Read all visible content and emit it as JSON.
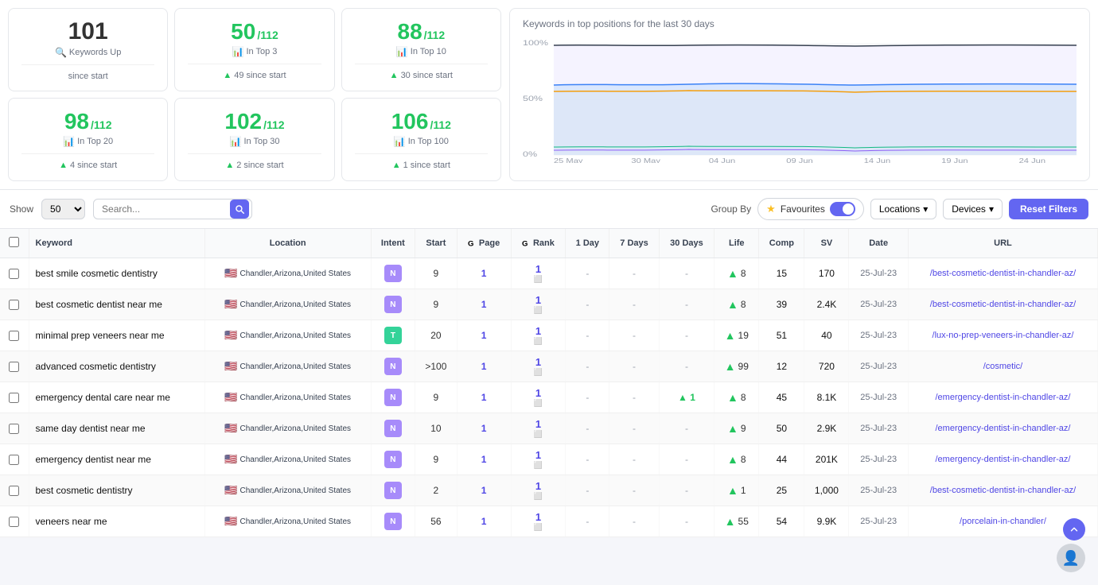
{
  "stats": [
    {
      "id": "keywords-up",
      "main": "101",
      "mainColor": "black",
      "icon": "🔍",
      "label": "Keywords Up",
      "since": "since start",
      "sinceArrow": false,
      "sinceNum": ""
    },
    {
      "id": "top3",
      "main": "50",
      "sup": "/112",
      "mainColor": "green",
      "icon": "📊",
      "label": "In Top 3",
      "since": "since start",
      "sinceArrow": true,
      "sinceNum": "49"
    },
    {
      "id": "top10",
      "main": "88",
      "sup": "/112",
      "mainColor": "green",
      "icon": "📊",
      "label": "In Top 10",
      "since": "since start",
      "sinceArrow": true,
      "sinceNum": "30"
    },
    {
      "id": "top20",
      "main": "98",
      "sup": "/112",
      "mainColor": "green",
      "icon": "📊",
      "label": "In Top 20",
      "since": "since start",
      "sinceArrow": true,
      "sinceNum": "4"
    },
    {
      "id": "top30",
      "main": "102",
      "sup": "/112",
      "mainColor": "green",
      "icon": "📊",
      "label": "In Top 30",
      "since": "since start",
      "sinceArrow": true,
      "sinceNum": "2"
    },
    {
      "id": "top100",
      "main": "106",
      "sup": "/112",
      "mainColor": "green",
      "icon": "📊",
      "label": "In Top 100",
      "since": "since start",
      "sinceArrow": true,
      "sinceNum": "1"
    }
  ],
  "chart": {
    "title": "Keywords in top positions for the last 30 days",
    "xLabels": [
      "25 May",
      "30 May",
      "04 Jun",
      "09 Jun",
      "14 Jun",
      "19 Jun",
      "24 Jun"
    ],
    "yLabels": [
      "0%",
      "50%",
      "100%"
    ]
  },
  "toolbar": {
    "show_label": "Show",
    "show_value": "50",
    "search_placeholder": "Search...",
    "group_by": "Group By",
    "favourites_label": "Favourites",
    "locations_label": "Locations",
    "devices_label": "Devices",
    "reset_label": "Reset Filters"
  },
  "table": {
    "columns": [
      "",
      "Keyword",
      "Location",
      "Intent",
      "Start",
      "Page",
      "Rank",
      "1 Day",
      "7 Days",
      "30 Days",
      "Life",
      "Comp",
      "SV",
      "Date",
      "URL"
    ],
    "rows": [
      {
        "keyword": "best smile cosmetic dentistry",
        "boldWords": [
          "smile",
          "cosmetic",
          "dentistry"
        ],
        "location": "Chandler,Arizona,United States",
        "intent": "N",
        "intentType": "n",
        "start": "9",
        "page": "1",
        "rank": "1",
        "day1": "-",
        "day7": "-",
        "day30": "-",
        "lifeArrow": "up",
        "life": "8",
        "comp": "15",
        "sv": "170",
        "date": "25-Jul-23",
        "url": "/best-cosmetic-dentist-in-chandler-az/"
      },
      {
        "keyword": "best cosmetic dentist near me",
        "boldWords": [
          "best",
          "cosmetic",
          "dentist"
        ],
        "location": "Chandler,Arizona,United States",
        "intent": "N",
        "intentType": "n",
        "start": "9",
        "page": "1",
        "rank": "1",
        "day1": "-",
        "day7": "-",
        "day30": "-",
        "lifeArrow": "up",
        "life": "8",
        "comp": "39",
        "sv": "2.4K",
        "date": "25-Jul-23",
        "url": "/best-cosmetic-dentist-in-chandler-az/"
      },
      {
        "keyword": "minimal prep veneers near me",
        "boldWords": [
          "minimal",
          "prep",
          "veneers"
        ],
        "location": "Chandler,Arizona,United States",
        "intent": "T",
        "intentType": "t",
        "start": "20",
        "page": "1",
        "rank": "1",
        "day1": "-",
        "day7": "-",
        "day30": "-",
        "lifeArrow": "up",
        "life": "19",
        "comp": "51",
        "sv": "40",
        "date": "25-Jul-23",
        "url": "/lux-no-prep-veneers-in-chandler-az/"
      },
      {
        "keyword": "advanced cosmetic dentistry",
        "boldWords": [
          "cosmetic",
          "dentistry"
        ],
        "location": "Chandler,Arizona,United States",
        "intent": "N",
        "intentType": "n",
        "start": ">100",
        "page": "1",
        "rank": "1",
        "day1": "-",
        "day7": "-",
        "day30": "-",
        "lifeArrow": "up",
        "life": "99",
        "comp": "12",
        "sv": "720",
        "date": "25-Jul-23",
        "url": "/cosmetic/"
      },
      {
        "keyword": "emergency dental care near me",
        "boldWords": [
          "emergency",
          "dental",
          "care"
        ],
        "location": "Chandler,Arizona,United States",
        "intent": "N",
        "intentType": "n",
        "start": "9",
        "page": "1",
        "rank": "1",
        "day1": "-",
        "day7": "-",
        "day30": "1",
        "lifeArrow": "up",
        "life": "8",
        "comp": "45",
        "sv": "8.1K",
        "date": "25-Jul-23",
        "url": "/emergency-dentist-in-chandler-az/"
      },
      {
        "keyword": "same day dentist near me",
        "boldWords": [
          "dentist"
        ],
        "location": "Chandler,Arizona,United States",
        "intent": "N",
        "intentType": "n",
        "start": "10",
        "page": "1",
        "rank": "1",
        "day1": "-",
        "day7": "-",
        "day30": "-",
        "lifeArrow": "up",
        "life": "9",
        "comp": "50",
        "sv": "2.9K",
        "date": "25-Jul-23",
        "url": "/emergency-dentist-in-chandler-az/"
      },
      {
        "keyword": "emergency dentist near me",
        "boldWords": [
          "emergency",
          "dentist"
        ],
        "location": "Chandler,Arizona,United States",
        "intent": "N",
        "intentType": "n",
        "start": "9",
        "page": "1",
        "rank": "1",
        "day1": "-",
        "day7": "-",
        "day30": "-",
        "lifeArrow": "up",
        "life": "8",
        "comp": "44",
        "sv": "201K",
        "date": "25-Jul-23",
        "url": "/emergency-dentist-in-chandler-az/"
      },
      {
        "keyword": "best cosmetic dentistry",
        "boldWords": [
          "cosmetic",
          "dentistry"
        ],
        "location": "Chandler,Arizona,United States",
        "intent": "N",
        "intentType": "n",
        "start": "2",
        "page": "1",
        "rank": "1",
        "day1": "-",
        "day7": "-",
        "day30": "-",
        "lifeArrow": "up",
        "life": "1",
        "comp": "25",
        "sv": "1,000",
        "date": "25-Jul-23",
        "url": "/best-cosmetic-dentist-in-chandler-az/"
      },
      {
        "keyword": "veneers near me",
        "boldWords": [
          "veneers"
        ],
        "location": "Chandler,Arizona,United States",
        "intent": "N",
        "intentType": "n",
        "start": "56",
        "page": "1",
        "rank": "1",
        "day1": "-",
        "day7": "-",
        "day30": "-",
        "lifeArrow": "up",
        "life": "55",
        "comp": "54",
        "sv": "9.9K",
        "date": "25-Jul-23",
        "url": "/porcelain-in-chandler/"
      }
    ]
  }
}
